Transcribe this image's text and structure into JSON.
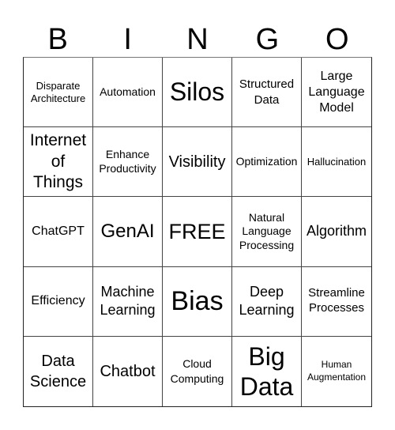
{
  "header": {
    "letters": [
      "B",
      "I",
      "N",
      "G",
      "O"
    ]
  },
  "card": {
    "cells": [
      [
        "Disparate Architecture",
        "Automation",
        "Silos",
        "Structured Data",
        "Large Language Model"
      ],
      [
        "Internet of Things",
        "Enhance Productivity",
        "Visibility",
        "Optimization",
        "Hallucination"
      ],
      [
        "ChatGPT",
        "GenAI",
        "FREE",
        "Natural Language Processing",
        "Algorithm"
      ],
      [
        "Efficiency",
        "Machine Learning",
        "Bias",
        "Deep Learning",
        "Streamline Processes"
      ],
      [
        "Data Science",
        "Chatbot",
        "Cloud Computing",
        "Big Data",
        "Human Augmentation"
      ]
    ]
  }
}
